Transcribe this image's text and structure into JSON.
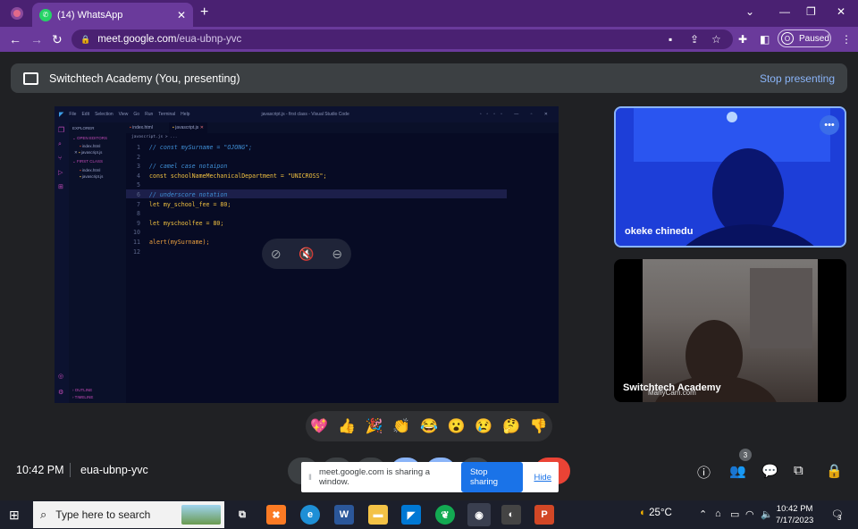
{
  "browser": {
    "tab_title": "(14) WhatsApp",
    "new_tab": "+",
    "url_host": "meet.google.com",
    "url_path": "/eua-ubnp-yvc",
    "profile_initial": "O",
    "profile_status": "Paused"
  },
  "banner": {
    "title": "Switchtech Academy (You, presenting)",
    "stop_label": "Stop presenting"
  },
  "vscode": {
    "menu": [
      "File",
      "Edit",
      "Selection",
      "View",
      "Go",
      "Run",
      "Terminal",
      "Help"
    ],
    "window_title": "javascript.js - first class - Visual Studio Code",
    "explorer_title": "EXPLORER",
    "open_editors": "OPEN EDITORS",
    "open_files": [
      "index.html",
      "javascript.js"
    ],
    "folder": "FIRST CLASS",
    "folder_files": [
      "index.html",
      "javascript.js"
    ],
    "outline": "OUTLINE",
    "timeline": "TIMELINE",
    "tabs": [
      "index.html",
      "javascript.js"
    ],
    "breadcrumb": "javascript.js > ...",
    "lines": [
      "// const mySurname = \"OJONG\";",
      "",
      "// camel case notaipon",
      "const schoolNameMechanicalDepartment = \"UNICROSS\";",
      "",
      "// underscore notation",
      "let my_school_fee = 80;",
      "",
      "let myschoolfee = 80;",
      "",
      "alert(mySurname);",
      ""
    ]
  },
  "participants": [
    {
      "name": "okeke chinedu"
    },
    {
      "name": "Switchtech Academy",
      "watermark": "ManyCam.com"
    }
  ],
  "reactions": [
    "💖",
    "👍",
    "🎉",
    "👏",
    "😂",
    "😮",
    "😢",
    "🤔",
    "👎"
  ],
  "meeting": {
    "time": "10:42 PM",
    "code": "eua-ubnp-yvc",
    "people_count": "3"
  },
  "share_notice": {
    "text": "meet.google.com is sharing a window.",
    "stop_label": "Stop sharing",
    "hide_label": "Hide"
  },
  "taskbar": {
    "search_placeholder": "Type here to search",
    "temperature": "25°C",
    "clock_time": "10:42 PM",
    "clock_date": "7/17/2023",
    "notification_count": "3"
  },
  "colors": {
    "browser_frame": "#4a2172",
    "accent_blue": "#8ab4f8",
    "end_call_red": "#ea4335"
  }
}
